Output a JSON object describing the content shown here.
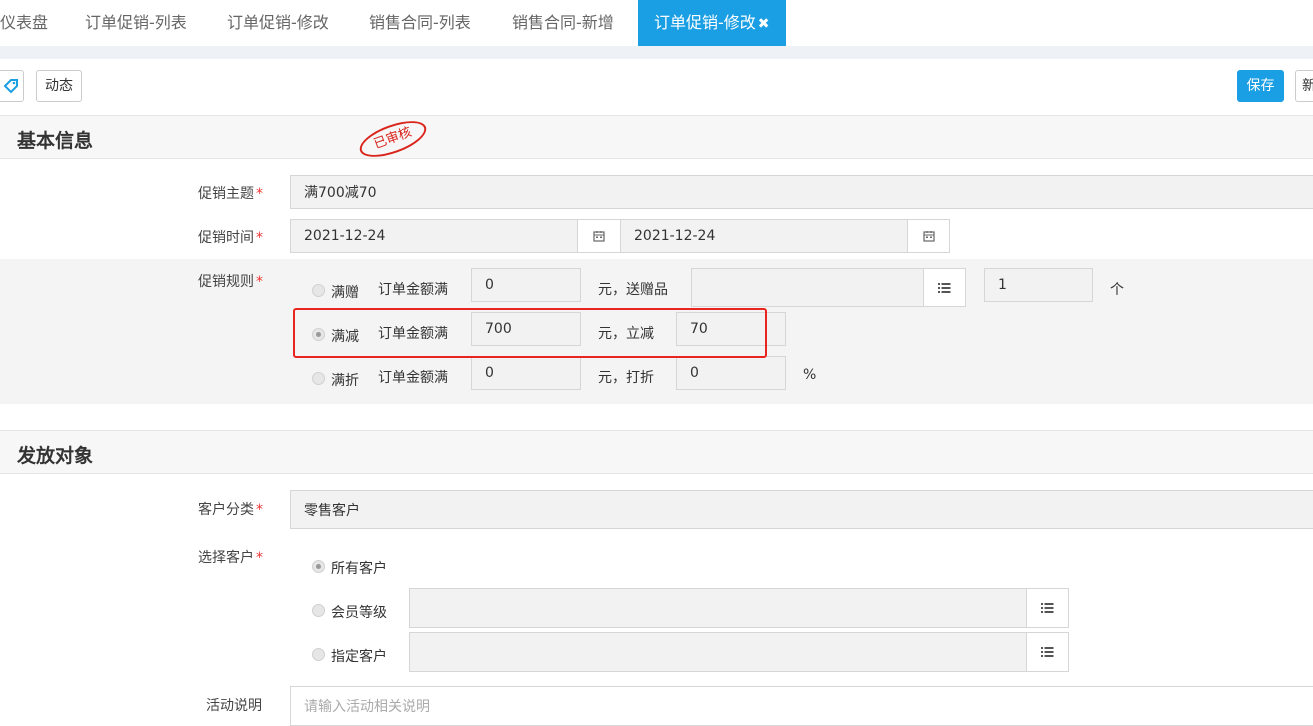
{
  "tabs": [
    {
      "label": "仪表盘"
    },
    {
      "label": "订单促销-列表"
    },
    {
      "label": "订单促销-修改"
    },
    {
      "label": "销售合同-列表"
    },
    {
      "label": "销售合同-新增"
    },
    {
      "label": "订单促销-修改",
      "active": true
    }
  ],
  "tab_close": "✖",
  "toolbar": {
    "dynamic_label": "动态",
    "save_label": "保存",
    "new_label": "新"
  },
  "stamp_text": "已审核",
  "sections": {
    "basic": "基本信息",
    "target": "发放对象"
  },
  "form": {
    "subject_label": "促销主题",
    "subject_value": "满700减70",
    "time_label": "促销时间",
    "start_date": "2021-12-24",
    "end_date": "2021-12-24",
    "rules_label": "促销规则",
    "required_mark": "*"
  },
  "rules": [
    {
      "option": "满赠",
      "prefix": "订单金额满",
      "amount": "0",
      "mid": "元，送赠品",
      "gift": "",
      "qty": "1",
      "unit": "个",
      "selected": false
    },
    {
      "option": "满减",
      "prefix": "订单金额满",
      "amount": "700",
      "mid": "元，立减",
      "value": "70",
      "selected": true
    },
    {
      "option": "满折",
      "prefix": "订单金额满",
      "amount": "0",
      "mid": "元，打折",
      "value": "0",
      "unit": "%",
      "selected": false
    }
  ],
  "target": {
    "category_label": "客户分类",
    "category_value": "零售客户",
    "select_label": "选择客户",
    "options": [
      {
        "label": "所有客户",
        "selected": true
      },
      {
        "label": "会员等级",
        "selected": false
      },
      {
        "label": "指定客户",
        "selected": false
      }
    ],
    "desc_label": "活动说明",
    "desc_placeholder": "请输入活动相关说明"
  },
  "colors": {
    "accent": "#1a9ee4",
    "highlight": "#e8261f",
    "stamp": "#d9251c"
  }
}
